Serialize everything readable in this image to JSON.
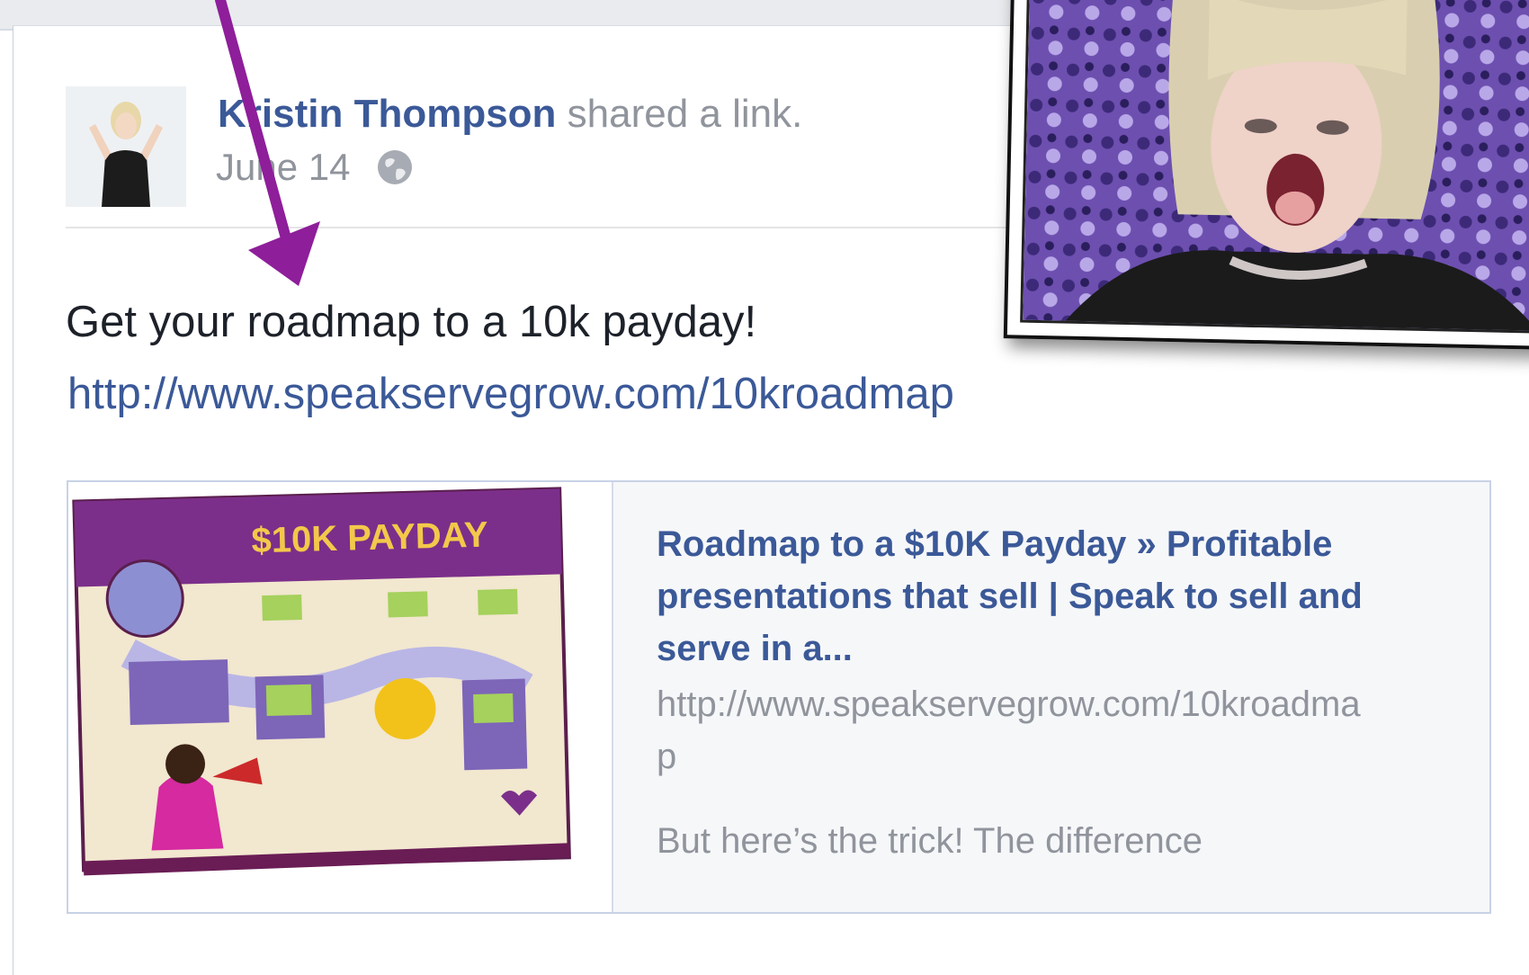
{
  "post": {
    "author_name": "Kristin Thompson",
    "action_text": "shared a link.",
    "date": "June 14",
    "privacy_icon": "globe-icon",
    "status_text": "Get your roadmap to a 10k payday!",
    "status_link": "http://www.speakservegrow.com/10kroadmap"
  },
  "link_card": {
    "thumbnail_heading": "$10K PAYDAY",
    "title": "Roadmap to a $10K Payday » Profitable presentations that sell | Speak to sell and serve in a...",
    "url": "http://www.speakservegrow.com/10kroadmap",
    "description": "But here’s the trick! The difference"
  },
  "colors": {
    "link_blue": "#3b5998",
    "meta_gray": "#90949c",
    "annotation_arrow": "#8e1e9a",
    "thumbnail_purple": "#7b2f8a"
  }
}
